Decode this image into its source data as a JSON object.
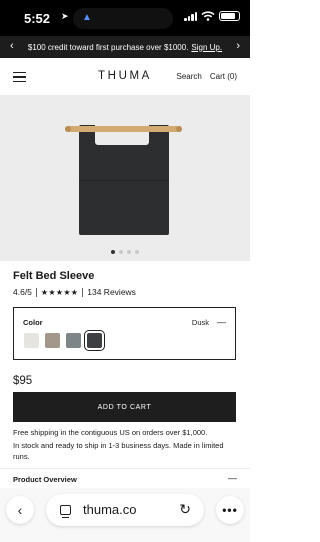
{
  "status_bar": {
    "time": "5:52",
    "location_icon": "location-arrow-icon",
    "island_icon": "navigation-arrow-icon",
    "battery_level": 0.8
  },
  "promo": {
    "text": "$100 credit toward first purchase over $1000.",
    "link": "Sign Up.",
    "prev_icon": "chevron-left-icon",
    "next_icon": "chevron-right-icon"
  },
  "header": {
    "menu_icon": "hamburger-menu-icon",
    "logo": "THUMA",
    "search": "Search",
    "cart": "Cart (0)"
  },
  "gallery": {
    "slides": 4,
    "active_slide": 1
  },
  "product": {
    "title": "Felt Bed Sleeve",
    "rating": "4.6/5",
    "stars": "★★★★★",
    "reviews": "134 Reviews",
    "price": "$95"
  },
  "color_selector": {
    "label": "Color",
    "selected": "Dusk",
    "collapse_icon": "minus-icon",
    "swatches": [
      {
        "name": "light",
        "color": "#e6e4df"
      },
      {
        "name": "taupe",
        "color": "#a3978b"
      },
      {
        "name": "slate",
        "color": "#7d8588"
      },
      {
        "name": "dusk",
        "color": "#3d3f43",
        "selected": true
      }
    ]
  },
  "cart": {
    "button": "ADD TO CART",
    "shipping_note": "Free shipping in the contiguous US on orders over $1,000.",
    "stock_note": "In stock and ready to ship in 1-3 business days. Made in limited runs."
  },
  "overview": {
    "label": "Product Overview",
    "icon": "minus-icon"
  },
  "browser": {
    "back_icon": "chevron-left-icon",
    "tabs_icon": "tabs-icon",
    "url": "thuma.co",
    "reload_icon": "reload-icon",
    "more_icon": "more-icon"
  }
}
